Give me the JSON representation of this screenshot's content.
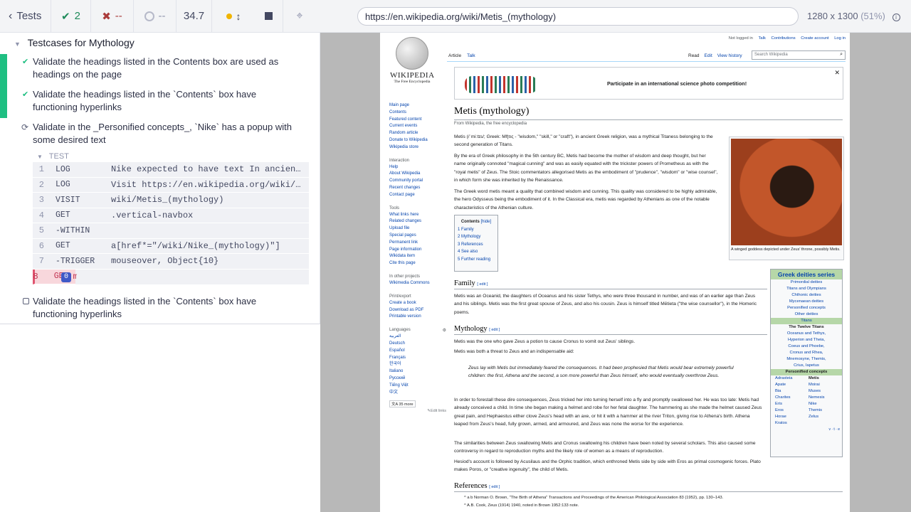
{
  "runner": {
    "tests_label": "Tests",
    "passed": "2",
    "failed": "--",
    "pending": "--",
    "duration": "34.7",
    "url": "https://en.wikipedia.org/wiki/Metis_(mythology)",
    "viewport": "1280 x 1300",
    "scale": "(51%)",
    "suite_title": "Testcases for Mythology",
    "tests": [
      {
        "title": "Validate the headings listed in the Contents box are used as headings on the page",
        "state": "passed"
      },
      {
        "title": "Validate the headings listed in the `Contents` box have functioning hyperlinks",
        "state": "passed"
      },
      {
        "title": "Validate in the _Personified concepts_, `Nike` has a popup with some desired text",
        "state": "running"
      },
      {
        "title": "Validate the headings listed in the `Contents` box have functioning hyperlinks",
        "state": "pending"
      }
    ],
    "test_section_label": "TEST",
    "commands": [
      {
        "n": "1",
        "name": "LOG",
        "msg": "Nike expected to have text In ancient Greek religion, Nike was a goddess"
      },
      {
        "n": "2",
        "name": "LOG",
        "msg": "Visit https://en.wikipedia.org/wiki/Metis_(mythology)"
      },
      {
        "n": "3",
        "name": "VISIT",
        "msg": "wiki/Metis_(mythology)"
      },
      {
        "n": "4",
        "name": "GET",
        "msg": ".vertical-navbox"
      },
      {
        "n": "5",
        "name": "-WITHIN",
        "msg": ""
      },
      {
        "n": "6",
        "name": "GET",
        "msg": "a[href*=\"/wiki/Nike_(mythology)\"]"
      },
      {
        "n": "7",
        "name": "-TRIGGER",
        "msg": "mouseover, Object{10}"
      },
      {
        "n": "8",
        "name": "GET",
        "msg": "mwe-popups",
        "badge": "0"
      }
    ]
  },
  "wiki": {
    "topbar": {
      "not_logged": "Not logged in",
      "talk": "Talk",
      "contrib": "Contributions",
      "create": "Create account",
      "login": "Log in"
    },
    "tabs": {
      "article": "Article",
      "talk": "Talk",
      "read": "Read",
      "edit": "Edit",
      "history": "View history",
      "search": "Search Wikipedia"
    },
    "logo_title": "Wikipedia",
    "logo_sub": "The Free Encyclopedia",
    "banner": "Participate in an international science photo competition!",
    "title": "Metis (mythology)",
    "from": "From Wikipedia, the free encyclopedia",
    "sidebar_main": [
      "Main page",
      "Contents",
      "Featured content",
      "Current events",
      "Random article",
      "Donate to Wikipedia",
      "Wikipedia store"
    ],
    "sidebar_interaction_h": "Interaction",
    "sidebar_interaction": [
      "Help",
      "About Wikipedia",
      "Community portal",
      "Recent changes",
      "Contact page"
    ],
    "sidebar_tools_h": "Tools",
    "sidebar_tools": [
      "What links here",
      "Related changes",
      "Upload file",
      "Special pages",
      "Permanent link",
      "Page information",
      "Wikidata item",
      "Cite this page"
    ],
    "sidebar_projects_h": "In other projects",
    "sidebar_projects": [
      "Wikimedia Commons"
    ],
    "sidebar_print_h": "Print/export",
    "sidebar_print": [
      "Create a book",
      "Download as PDF",
      "Printable version"
    ],
    "sidebar_lang_h": "Languages",
    "sidebar_lang": [
      "العربية",
      "Deutsch",
      "Español",
      "Français",
      "한국어",
      "Italiano",
      "Русский",
      "Tiếng Việt",
      "中文"
    ],
    "more_langs": "35 more",
    "edit_links": "Edit links",
    "para1": "Metis (/ˈmiːtɪs/; Greek: Μῆτις - \"wisdom,\" \"skill,\" or \"craft\"), in ancient Greek religion, was a mythical Titaness belonging to the second generation of Titans.",
    "para2": "By the era of Greek philosophy in the 5th century BC, Metis had become the mother of wisdom and deep thought, but her name originally connoted \"magical cunning\" and was as easily equated with the trickster powers of Prometheus as with the \"royal metis\" of Zeus. The Stoic commentators allegorised Metis as the embodiment of \"prudence\", \"wisdom\" or \"wise counsel\", in which form she was inherited by the Renaissance.",
    "para3": "The Greek word metis meant a quality that combined wisdom and cunning. This quality was considered to be highly admirable, the hero Odysseus being the embodiment of it. In the Classical era, metis was regarded by Athenians as one of the notable characteristics of the Athenian culture.",
    "image_caption": "A winged goddess depicted under Zeus' throne, possibly Metis.",
    "contents_title": "Contents",
    "contents_hide": "[hide]",
    "contents": [
      "1  Family",
      "2  Mythology",
      "3  References",
      "4  See also",
      "5  Further reading"
    ],
    "family_h": "Family",
    "edit_label": "[ edit ]",
    "family_p": "Metis was an Oceanid, the daughters of Oceanus and his sister Tethys, who were three thousand in number, and was of an earlier age than Zeus and his siblings. Metis was the first great spouse of Zeus, and also his cousin. Zeus is himself titled Mētieta (\"the wise counsellor\"), in the Homeric poems.",
    "myth_h": "Mythology",
    "myth_p1": "Metis was the one who gave Zeus a potion to cause Cronus to vomit out Zeus' siblings.",
    "myth_p2": "Metis was both a threat to Zeus and an indispensable aid:",
    "quote": "Zeus lay with Metis but immediately feared the consequences. It had been prophesied that Metis would bear extremely powerful children: the first, Athena and the second, a son more powerful than Zeus himself, who would eventually overthrow Zeus.",
    "myth_p3": "In order to forestall these dire consequences, Zeus tricked her into turning herself into a fly and promptly swallowed her. He was too late: Metis had already conceived a child. In time she began making a helmet and robe for her fetal daughter. The hammering as she made the helmet caused Zeus great pain, and Hephaestus either clove Zeus's head with an axe, or hit it with a hammer at the river Triton, giving rise to Athena's birth. Athena leaped from Zeus's head, fully grown, armed, and armoured, and Zeus was none the worse for the experience.",
    "myth_p4": "The similarities between Zeus swallowing Metis and Cronus swallowing his children have been noted by several scholars. This also caused some controversy in regard to reproduction myths and the likely role of women as a means of reproduction.",
    "myth_p5": "Hesiod's account is followed by Acusilaus and the Orphic tradition, which enthroned Metis side by side with Eros as primal cosmogenic forces. Plato makes Poros, or \"creative ingenuity\", the child of Metis.",
    "refs_h": "References",
    "ref1": "^ a b Norman O. Brown, \"The Birth of Athena\" Transactions and Proceedings of the American Philological Association 83 (1952), pp. 130–143.",
    "ref2": "^ A.B. Cook, Zeus (1914) 1940, noted in Brown 1952:133 note.",
    "infobox": {
      "title": "Greek deities series",
      "links": [
        "Primordial deities",
        "Titans and Olympians",
        "Chthonic deities",
        "Mycenaean deities",
        "Personified concepts",
        "Other deities"
      ],
      "titans_h": "Titans",
      "twelve_h": "The Twelve Titans",
      "twelve": [
        "Oceanus and Tethys,",
        "Hyperion and Theia,",
        "Coeus and Phoebe,",
        "Cronus and Rhea,",
        "Mnemosyne, Themis,",
        "Crius, Iapetus"
      ],
      "pers_h": "Personified concepts",
      "pers_left": [
        "Adrasteia",
        "Apate",
        "Bia",
        "Charites",
        "Eris",
        "Eros",
        "Horae",
        "Kratos"
      ],
      "pers_right": [
        "Metis",
        "Moirai",
        "Muses",
        "Nemesis",
        "Nike",
        "Themis",
        "Zelus"
      ],
      "vte": "v · t · e"
    }
  }
}
